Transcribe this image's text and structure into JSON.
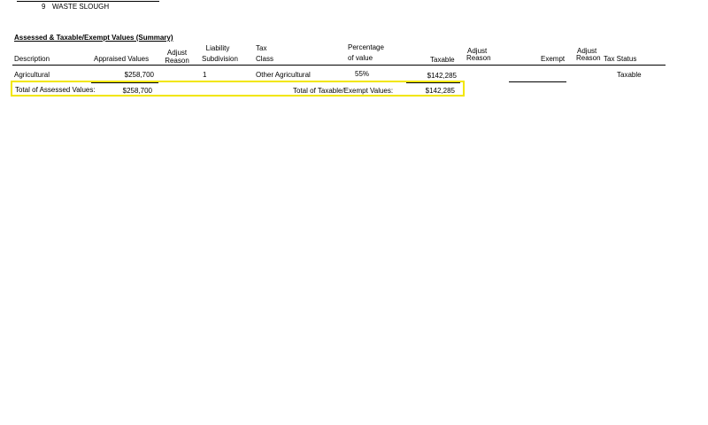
{
  "top_row": {
    "number": "9",
    "label": "WASTE SLOUGH"
  },
  "summary": {
    "title": "Assessed & Taxable/Exempt Values (Summary)",
    "headers": {
      "description": "Description",
      "appraised_values": "Appraised Values",
      "adjust_reason_1_line1": "Adjust",
      "adjust_reason_1_line2": "Reason",
      "liability_line1": "Liability",
      "liability_line2": "Subdivision",
      "tax_class_line1": "Tax",
      "tax_class_line2": "Class",
      "percentage_line1": "Percentage",
      "percentage_line2": "of value",
      "taxable": "Taxable",
      "adjust_reason_2_line1": "Adjust",
      "adjust_reason_2_line2": "Reason",
      "exempt": "Exempt",
      "adjust_reason_3_line1": "Adjust",
      "adjust_reason_3_line2": "Reason",
      "tax_status": "Tax Status"
    },
    "row": {
      "description": "Agricultural",
      "appraised_value": "$258,700",
      "liability_subdivision": "1",
      "tax_class": "Other Agricultural",
      "percentage": "55%",
      "taxable": "$142,285",
      "tax_status": "Taxable"
    },
    "totals": {
      "assessed_label": "Total of Assessed Values:",
      "assessed_value": "$258,700",
      "taxable_exempt_label": "Total of Taxable/Exempt Values:",
      "taxable_value": "$142,285"
    }
  }
}
